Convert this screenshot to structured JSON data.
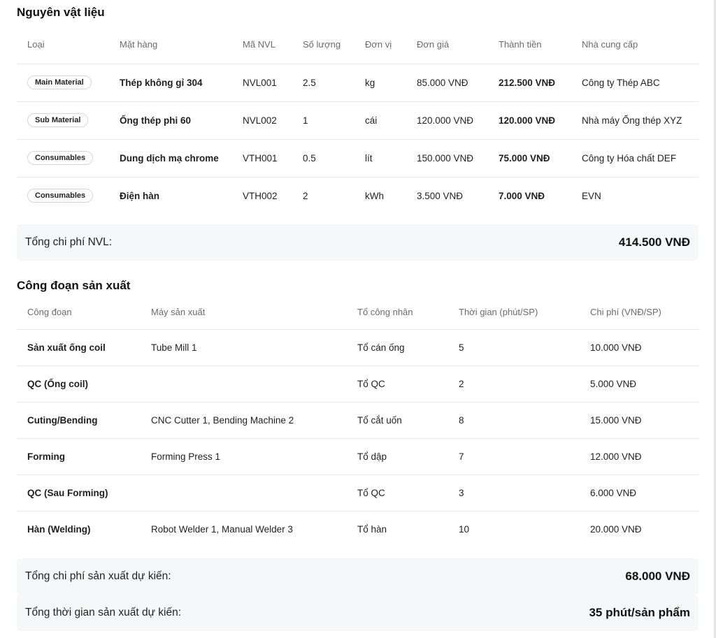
{
  "materials": {
    "title": "Nguyên vật liệu",
    "headers": [
      "Loại",
      "Mặt hàng",
      "Mã NVL",
      "Số lượng",
      "Đơn vị",
      "Đơn giá",
      "Thành tiền",
      "Nhà cung cấp"
    ],
    "rows": [
      {
        "type": "Main Material",
        "item": "Thép không gỉ 304",
        "code": "NVL001",
        "qty": "2.5",
        "unit": "kg",
        "price": "85.000 VNĐ",
        "total": "212.500 VNĐ",
        "supplier": "Công ty Thép ABC"
      },
      {
        "type": "Sub Material",
        "item": "Ống thép phi 60",
        "code": "NVL002",
        "qty": "1",
        "unit": "cái",
        "price": "120.000 VNĐ",
        "total": "120.000 VNĐ",
        "supplier": "Nhà máy Ống thép XYZ"
      },
      {
        "type": "Consumables",
        "item": "Dung dịch mạ chrome",
        "code": "VTH001",
        "qty": "0.5",
        "unit": "lít",
        "price": "150.000 VNĐ",
        "total": "75.000 VNĐ",
        "supplier": "Công ty Hóa chất DEF"
      },
      {
        "type": "Consumables",
        "item": "Điện hàn",
        "code": "VTH002",
        "qty": "2",
        "unit": "kWh",
        "price": "3.500 VNĐ",
        "total": "7.000 VNĐ",
        "supplier": "EVN"
      }
    ],
    "summary_label": "Tổng chi phí NVL:",
    "summary_value": "414.500 VNĐ"
  },
  "production": {
    "title": "Công đoạn sản xuất",
    "headers": [
      "Công đoạn",
      "Máy sản xuất",
      "Tổ công nhân",
      "Thời gian (phút/SP)",
      "Chi phí (VNĐ/SP)"
    ],
    "rows": [
      {
        "stage": "Sản xuất ống coil",
        "machine": "Tube Mill 1",
        "team": "Tổ cán ống",
        "time": "5",
        "cost": "10.000 VNĐ"
      },
      {
        "stage": "QC (Ống coil)",
        "machine": "",
        "team": "Tổ QC",
        "time": "2",
        "cost": "5.000 VNĐ"
      },
      {
        "stage": "Cuting/Bending",
        "machine": "CNC Cutter 1, Bending Machine 2",
        "team": "Tổ cắt uốn",
        "time": "8",
        "cost": "15.000 VNĐ"
      },
      {
        "stage": "Forming",
        "machine": "Forming Press 1",
        "team": "Tổ dập",
        "time": "7",
        "cost": "12.000 VNĐ"
      },
      {
        "stage": "QC (Sau Forming)",
        "machine": "",
        "team": "Tổ QC",
        "time": "3",
        "cost": "6.000 VNĐ"
      },
      {
        "stage": "Hàn (Welding)",
        "machine": "Robot Welder 1, Manual Welder 3",
        "team": "Tổ hàn",
        "time": "10",
        "cost": "20.000 VNĐ"
      }
    ],
    "cost_label": "Tổng chi phí sản xuất dự kiến:",
    "cost_value": "68.000 VNĐ",
    "time_label": "Tổng thời gian sản xuất dự kiến:",
    "time_value": "35 phút/sản phẩm"
  }
}
